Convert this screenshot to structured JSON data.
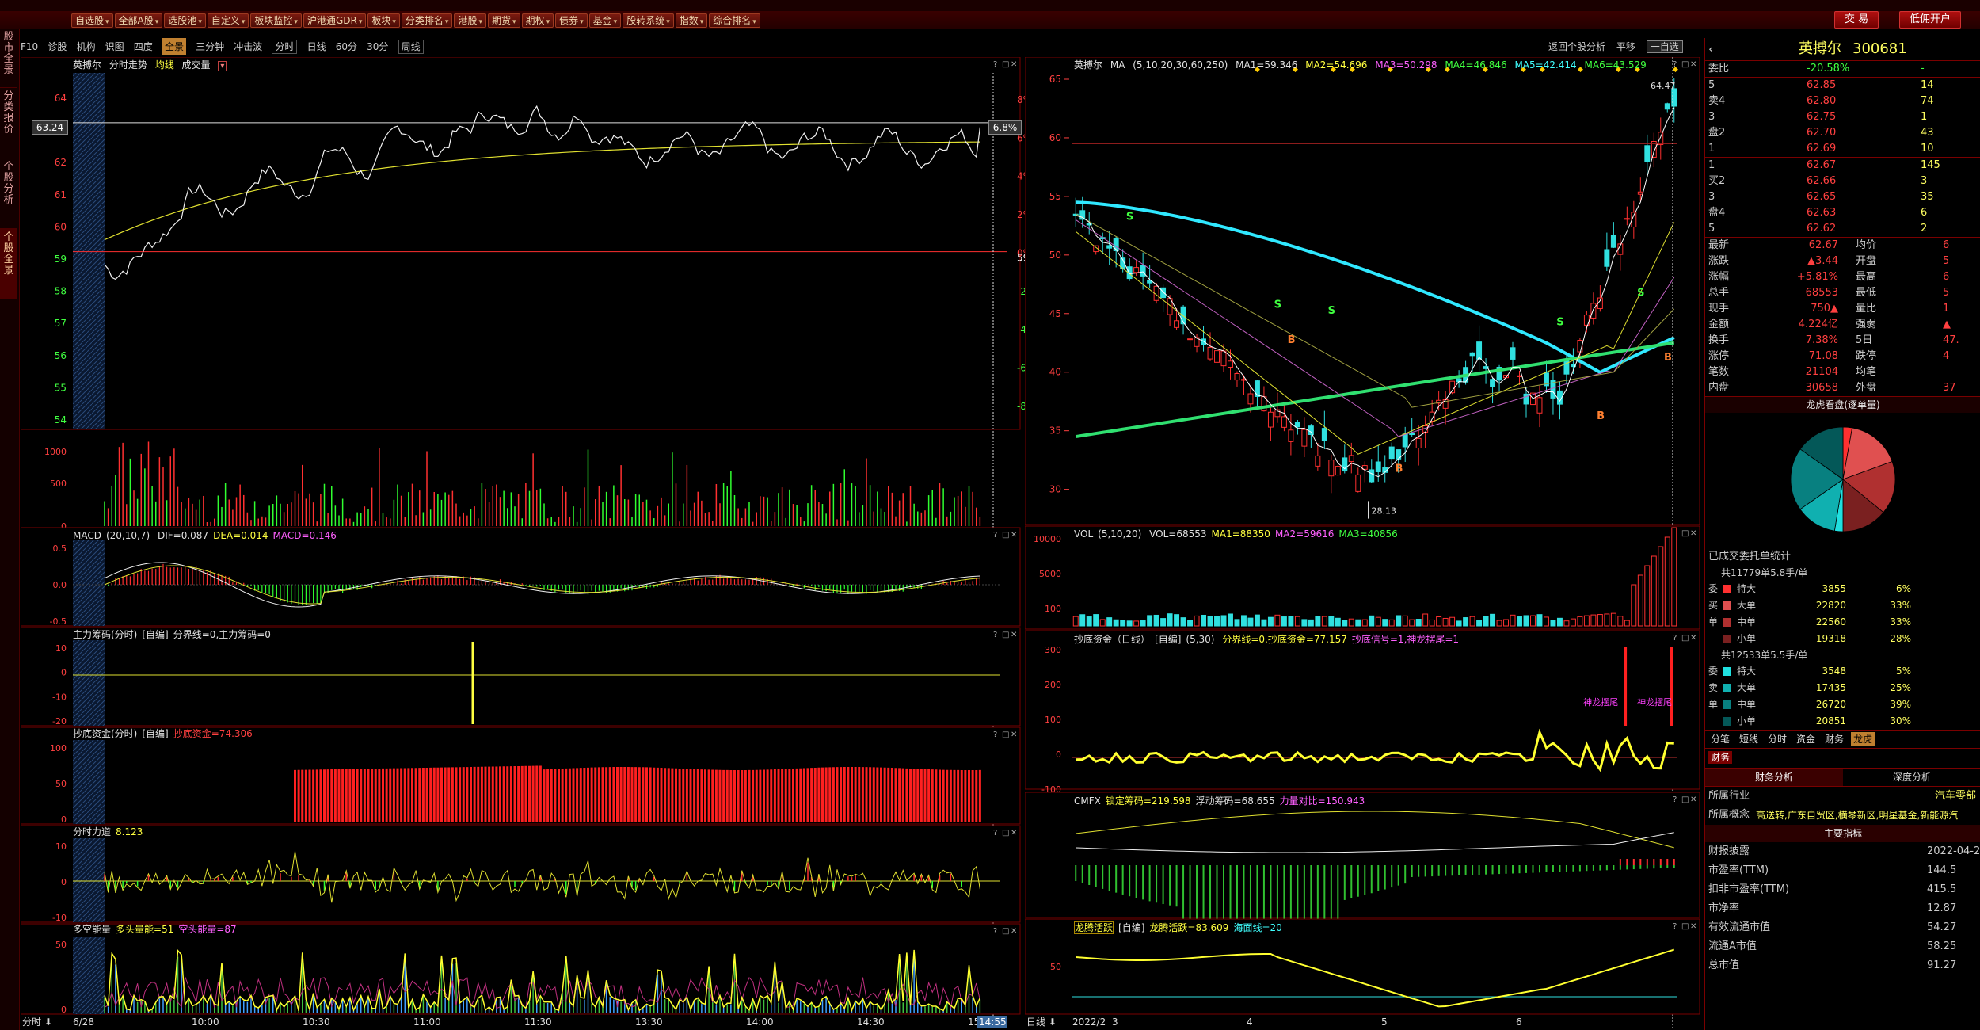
{
  "toolbar": {
    "buttons": [
      "自选股",
      "全部A股",
      "选股池",
      "自定义",
      "板块监控",
      "沪港通GDR",
      "板块",
      "分类排名",
      "港股",
      "期货",
      "期权",
      "债券",
      "基金",
      "股转系统",
      "指数",
      "综合排名"
    ],
    "right_buttons": [
      "交 易",
      "低佣开户"
    ]
  },
  "left_tabs": [
    "股市全景",
    "分类报价",
    "个股分析",
    "个股全景"
  ],
  "nav": {
    "items": [
      "F10",
      "诊股",
      "机构",
      "识图",
      "四度",
      "全景",
      "三分钟",
      "冲击波"
    ],
    "period_items": [
      "分时",
      "日线",
      "60分",
      "30分",
      "周线"
    ],
    "right_items": [
      "返回个股分析",
      "平移",
      "一自选"
    ]
  },
  "intraday": {
    "title_name": "英搏尔",
    "title_parts": [
      "分时走势",
      "均线",
      "成交量"
    ],
    "price_ticks": [
      "64",
      "63",
      "62",
      "61",
      "60",
      "59",
      "58",
      "57",
      "56",
      "55",
      "54"
    ],
    "pct_ticks": [
      "8%",
      "6%",
      "4%",
      "2%",
      "0%",
      "-2%",
      "-4%",
      "-6%",
      "-8%"
    ],
    "current_price": "63.24",
    "current_pct": "6.8%",
    "prev_close": "59.23",
    "vol_ticks": [
      "1000",
      "500",
      "0"
    ],
    "date": "6/28",
    "time_labels": [
      "10:00",
      "10:30",
      "11:00",
      "11:30",
      "13:30",
      "14:00",
      "14:30",
      "15:00"
    ],
    "cursor_time": "14:55",
    "corner_label": "分时"
  },
  "macd_i": {
    "title": "MACD",
    "params": "(20,10,7)",
    "dif": "DIF=0.087",
    "dea": "DEA=0.014",
    "macd": "MACD=0.146",
    "ticks": [
      "0.5",
      "0.0",
      "-0.5"
    ]
  },
  "zljm": {
    "title": "主力筹码(分时)",
    "sub": "[自编]",
    "text": "分界线=0,主力筹码=0",
    "ticks": [
      "10",
      "0",
      "-10",
      "-20"
    ]
  },
  "cdzj_i": {
    "title": "抄底资金(分时)",
    "sub": "[自编]",
    "text": "抄底资金=74.306",
    "ticks": [
      "100",
      "50",
      "0"
    ]
  },
  "fsld": {
    "title": "分时力道",
    "value": "8.123",
    "ticks": [
      "10",
      "0",
      "-10"
    ]
  },
  "dknl": {
    "title": "多空能量",
    "t1": "多头量能=51",
    "t2": "空头能量=87",
    "ticks": [
      "50",
      "0"
    ]
  },
  "daily": {
    "title_name": "英搏尔",
    "ma_label": "MA",
    "ma_params": "(5,10,20,30,60,250)",
    "mas": [
      "MA1=59.346",
      "MA2=54.696",
      "MA3=50.298",
      "MA4=46.846",
      "MA5=42.414",
      "MA6=43.529"
    ],
    "price_ticks": [
      "65",
      "60",
      "55",
      "50",
      "45",
      "40",
      "35",
      "30"
    ],
    "high_label": "64.47",
    "low_label": "28.13",
    "date_labels": [
      "2022/2",
      "3",
      "4",
      "5",
      "6"
    ],
    "corner_label": "日线"
  },
  "vol_d": {
    "title": "VOL",
    "params": "(5,10,20)",
    "vol": "VOL=68553",
    "ma1": "MA1=88350",
    "ma2": "MA2=59616",
    "ma3": "MA3=40856",
    "ticks": [
      "10000",
      "5000",
      "100"
    ]
  },
  "cdzj_d": {
    "title": "抄底资金（日线）",
    "sub": "[自编]",
    "params": "(5,30)",
    "text1": "分界线=0,抄底资金=77.157",
    "text2": "抄底信号=1,神龙摆尾=1",
    "ticks": [
      "300",
      "200",
      "100",
      "0",
      "-100"
    ],
    "annot": [
      "神龙摆尾",
      "神龙摆尾"
    ]
  },
  "cmfx": {
    "title": "CMFX",
    "t1": "锁定筹码=219.598",
    "t2": "浮动筹码=68.655",
    "t3": "力量对比=150.943"
  },
  "lthy": {
    "title": "龙腾活跃",
    "sub": "[自编]",
    "t1": "龙腾活跃=83.609",
    "t2": "海面线=20",
    "ticks": [
      "50"
    ]
  },
  "quote": {
    "name": "英搏尔",
    "code": "300681",
    "weibi_label": "委比",
    "weibi": "-20.58%",
    "weicha": "-",
    "sell": [
      {
        "label": "5",
        "price": "62.85",
        "vol": "14"
      },
      {
        "label": "卖4",
        "price": "62.80",
        "vol": "74"
      },
      {
        "label": "3",
        "price": "62.75",
        "vol": "1"
      },
      {
        "label": "盘2",
        "price": "62.70",
        "vol": "43"
      },
      {
        "label": "1",
        "price": "62.69",
        "vol": "10"
      }
    ],
    "buy": [
      {
        "label": "1",
        "price": "62.67",
        "vol": "145"
      },
      {
        "label": "买2",
        "price": "62.66",
        "vol": "3"
      },
      {
        "label": "3",
        "price": "62.65",
        "vol": "35"
      },
      {
        "label": "盘4",
        "price": "62.63",
        "vol": "6"
      },
      {
        "label": "5",
        "price": "62.62",
        "vol": "2"
      }
    ],
    "stats": [
      {
        "l": "最新",
        "v": "62.67",
        "l2": "均价",
        "v2": "6"
      },
      {
        "l": "涨跌",
        "v": "▲3.44",
        "l2": "开盘",
        "v2": "5"
      },
      {
        "l": "涨幅",
        "v": "+5.81%",
        "l2": "最高",
        "v2": "6"
      },
      {
        "l": "总手",
        "v": "68553",
        "l2": "最低",
        "v2": "5"
      },
      {
        "l": "现手",
        "v": "750▲",
        "l2": "量比",
        "v2": "1"
      },
      {
        "l": "金额",
        "v": "4.224亿",
        "l2": "强弱",
        "v2": "▲"
      },
      {
        "l": "换手",
        "v": "7.38%",
        "l2": "5日",
        "v2": "47."
      },
      {
        "l": "涨停",
        "v": "71.08",
        "l2": "跌停",
        "v2": "4"
      },
      {
        "l": "笔数",
        "v": "21104",
        "l2": "均笔",
        "v2": ""
      },
      {
        "l": "内盘",
        "v": "30658",
        "l2": "外盘",
        "v2": "37"
      }
    ],
    "lhkp_title": "龙虎看盘(逐单量)",
    "ycj_title": "已成交委托单统计",
    "buy_sum": "共11779单5.8手/单",
    "buy_rows": [
      {
        "side": "委",
        "name": "特大",
        "v": "3855",
        "p": "6%",
        "c": "#ff3030"
      },
      {
        "side": "买",
        "name": "大单",
        "v": "22820",
        "p": "33%",
        "c": "#e05050"
      },
      {
        "side": "单",
        "name": "中单",
        "v": "22560",
        "p": "33%",
        "c": "#b03030"
      },
      {
        "side": "",
        "name": "小单",
        "v": "19318",
        "p": "28%",
        "c": "#7a2020"
      }
    ],
    "sell_sum": "共12533单5.5手/单",
    "sell_rows": [
      {
        "side": "委",
        "name": "特大",
        "v": "3548",
        "p": "5%",
        "c": "#20e0e0"
      },
      {
        "side": "卖",
        "name": "大单",
        "v": "17435",
        "p": "25%",
        "c": "#10b0b0"
      },
      {
        "side": "单",
        "name": "中单",
        "v": "26720",
        "p": "39%",
        "c": "#088080"
      },
      {
        "side": "",
        "name": "小单",
        "v": "20851",
        "p": "30%",
        "c": "#045858"
      }
    ],
    "tabs": [
      "分笔",
      "短线",
      "分时",
      "资金",
      "财务",
      "龙虎"
    ],
    "cw_tab": "财务",
    "cw_tabs": [
      "财务分析",
      "深度分析"
    ],
    "industry_label": "所属行业",
    "industry": "汽车零部",
    "concept_label": "所属概念",
    "concepts": "高送转,广东自贸区,横琴新区,明星基金,新能源汽",
    "indicator_title": "主要指标",
    "metrics": [
      {
        "l": "财报披露",
        "v": "2022-04-22"
      },
      {
        "l": "市盈率(TTM)",
        "v": "144.5"
      },
      {
        "l": "扣非市盈率(TTM)",
        "v": "415.5"
      },
      {
        "l": "市净率",
        "v": "12.87"
      },
      {
        "l": "有效流通市值",
        "v": "54.27"
      },
      {
        "l": "流通A市值",
        "v": "58.25"
      },
      {
        "l": "总市值",
        "v": "91.27"
      }
    ]
  },
  "colors": {
    "up": "#ff3030",
    "down": "#30ff30",
    "border": "#7a0000",
    "ma_cyan": "#30e8ff",
    "ma_green": "#30e070"
  }
}
